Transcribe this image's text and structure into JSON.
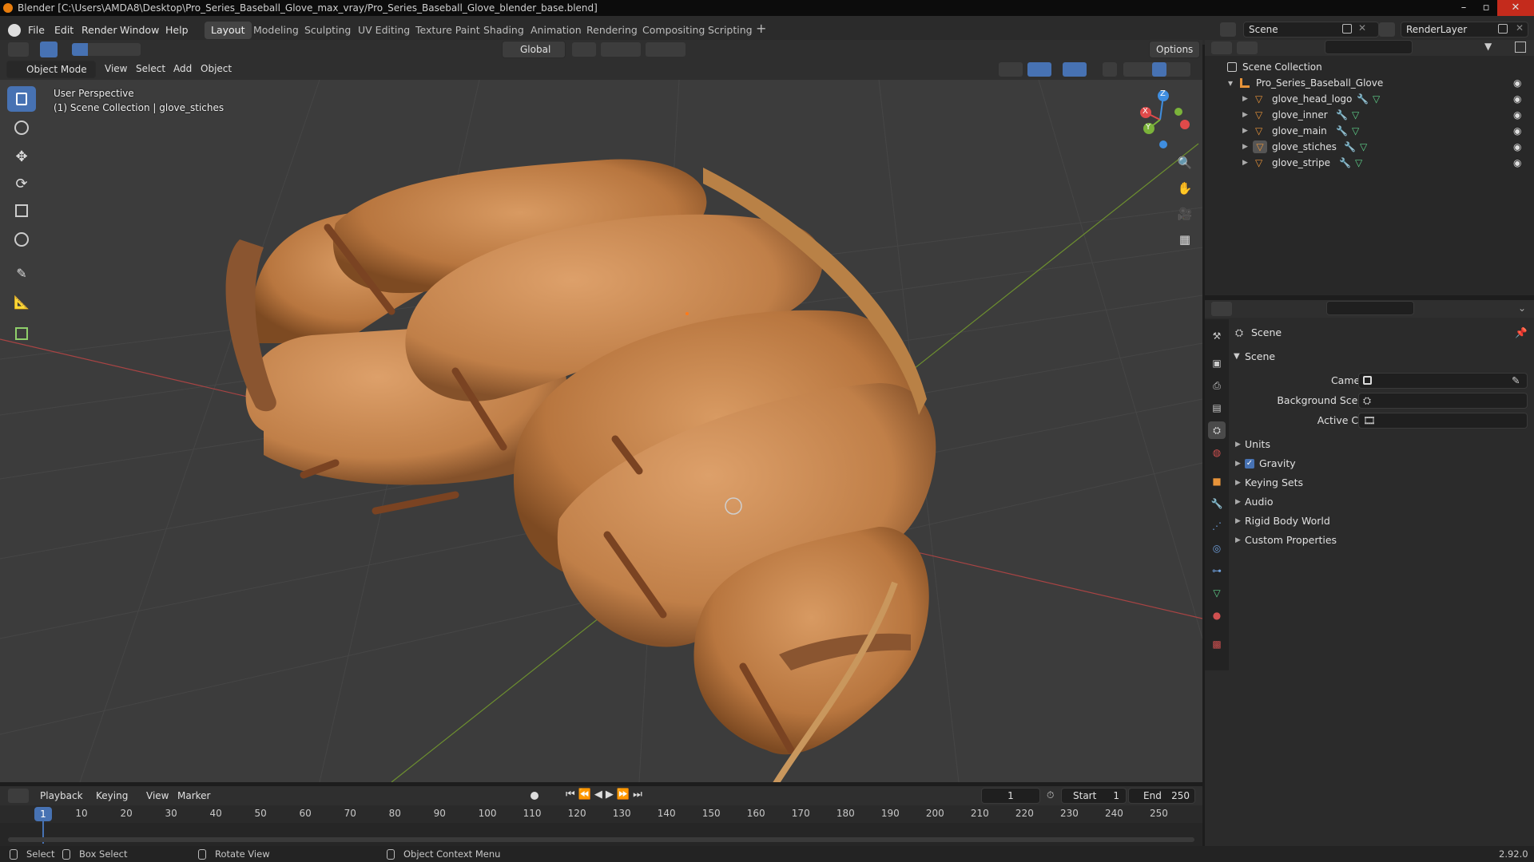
{
  "titlebar": {
    "title": "Blender [C:\\Users\\AMDA8\\Desktop\\Pro_Series_Baseball_Glove_max_vray/Pro_Series_Baseball_Glove_blender_base.blend]"
  },
  "menu": {
    "file": "File",
    "edit": "Edit",
    "render": "Render",
    "window": "Window",
    "help": "Help"
  },
  "workspaces": [
    "Layout",
    "Modeling",
    "Sculpting",
    "UV Editing",
    "Texture Paint",
    "Shading",
    "Animation",
    "Rendering",
    "Compositing",
    "Scripting"
  ],
  "scene_field": "Scene",
  "renderlayer_field": "RenderLayer",
  "viewport": {
    "transform_orientation": "Global",
    "options_label": "Options",
    "mode": "Object Mode",
    "menus": {
      "view": "View",
      "select": "Select",
      "add": "Add",
      "object": "Object"
    },
    "perspective_label": "User Perspective",
    "collection_label": "(1) Scene Collection | glove_stiches",
    "gizmo": {
      "x": "X",
      "y": "Y",
      "z": "Z"
    }
  },
  "outliner": {
    "root": "Scene Collection",
    "collection": "Pro_Series_Baseball_Glove",
    "objects": [
      "glove_head_logo",
      "glove_inner",
      "glove_main",
      "glove_stiches",
      "glove_stripe"
    ]
  },
  "properties": {
    "header": "Scene",
    "panel": "Scene",
    "fields": {
      "camera": "Camera",
      "background_scene": "Background Scene",
      "active_clip": "Active Clip"
    },
    "subpanels": {
      "units": "Units",
      "gravity": "Gravity",
      "keying_sets": "Keying Sets",
      "audio": "Audio",
      "rigid_body_world": "Rigid Body World",
      "custom_properties": "Custom Properties"
    }
  },
  "timeline": {
    "menus": {
      "playback": "Playback",
      "keying": "Keying",
      "view": "View",
      "marker": "Marker"
    },
    "current_frame": "1",
    "start_label": "Start",
    "start": "1",
    "end_label": "End",
    "end": "250",
    "ticks": [
      "1",
      "10",
      "20",
      "30",
      "40",
      "50",
      "60",
      "70",
      "80",
      "90",
      "100",
      "110",
      "120",
      "130",
      "140",
      "150",
      "160",
      "170",
      "180",
      "190",
      "200",
      "210",
      "220",
      "230",
      "240",
      "250"
    ]
  },
  "statusbar": {
    "select": "Select",
    "box_select": "Box Select",
    "rotate_view": "Rotate View",
    "context_menu": "Object Context Menu",
    "version": "2.92.0"
  },
  "colors": {
    "accent": "#4772b3",
    "x_axis": "#e04a4a",
    "y_axis": "#7bb33a",
    "z_axis": "#3f8ee0",
    "leather": "#c98a55",
    "object_orange": "#e8943a"
  }
}
